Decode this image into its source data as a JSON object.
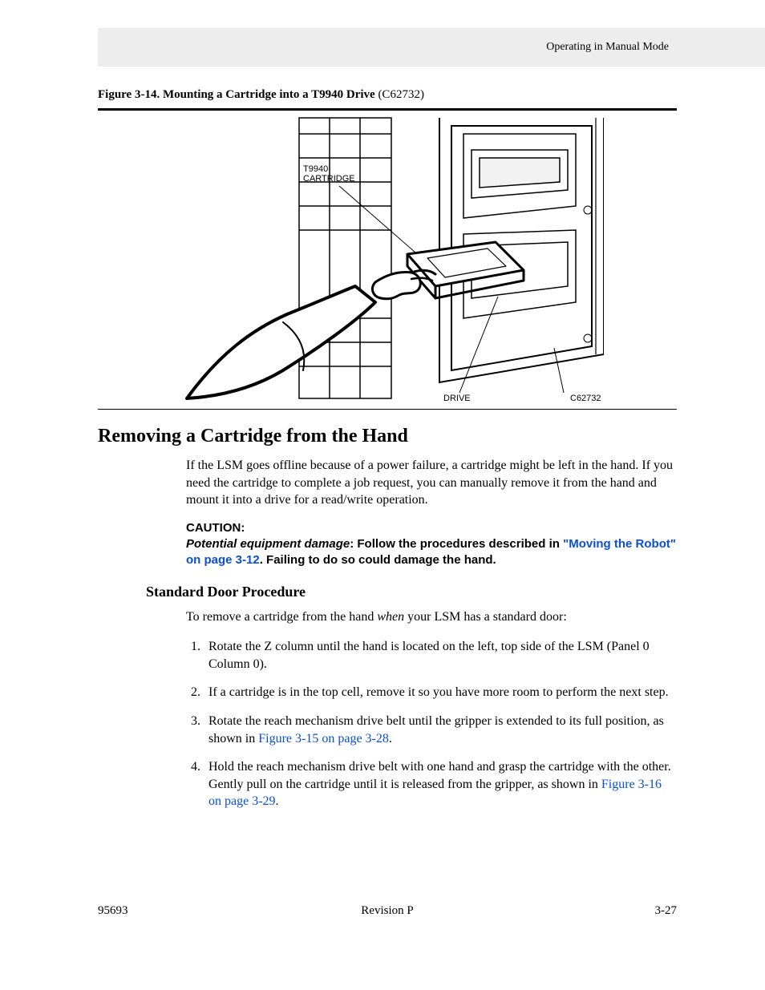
{
  "header": {
    "running_head": "Operating in Manual Mode"
  },
  "figure": {
    "label_bold": "Figure 3-14. Mounting a Cartridge into a T9940 Drive",
    "label_code": "  (C62732)",
    "svg_labels": {
      "cartridge_line1": "T9940",
      "cartridge_line2": "CARTRIDGE",
      "drive": "DRIVE",
      "code": "C62732"
    }
  },
  "section_heading": "Removing a Cartridge from the Hand",
  "intro_para": "If the LSM goes offline because of a power failure, a cartridge might be left in the hand. If you need the cartridge to complete a job request, you can manually remove it from the hand and mount it into a drive for a read/write operation.",
  "caution": {
    "heading": "CAUTION:",
    "warning_ital": "Potential equipment damage",
    "body_before_link": ": Follow the procedures described in ",
    "link_text": "\"Moving the Robot\" on page 3-12",
    "body_after_link": ". Failing to do so could damage the hand."
  },
  "subheading": "Standard Door Procedure",
  "lead_in_before_ital": "To remove a cartridge from the hand ",
  "lead_in_ital": "when",
  "lead_in_after_ital": " your LSM has a standard door:",
  "steps": [
    {
      "text": "Rotate the Z column until the hand is located on the left, top side of the LSM (Panel 0 Column 0)."
    },
    {
      "text": "If a cartridge is in the top cell, remove it so you have more room to perform the next step."
    },
    {
      "before": "Rotate the reach mechanism drive belt until the gripper is extended to its full position, as shown in ",
      "link": "Figure 3-15 on page 3-28",
      "after": "."
    },
    {
      "before": "Hold the reach mechanism drive belt with one hand and grasp the cartridge with the other. Gently pull on the cartridge until it is released from the gripper, as shown in ",
      "link": "Figure 3-16 on page 3-29",
      "after": "."
    }
  ],
  "footer": {
    "left": "95693",
    "center": "Revision P",
    "right": "3-27"
  }
}
